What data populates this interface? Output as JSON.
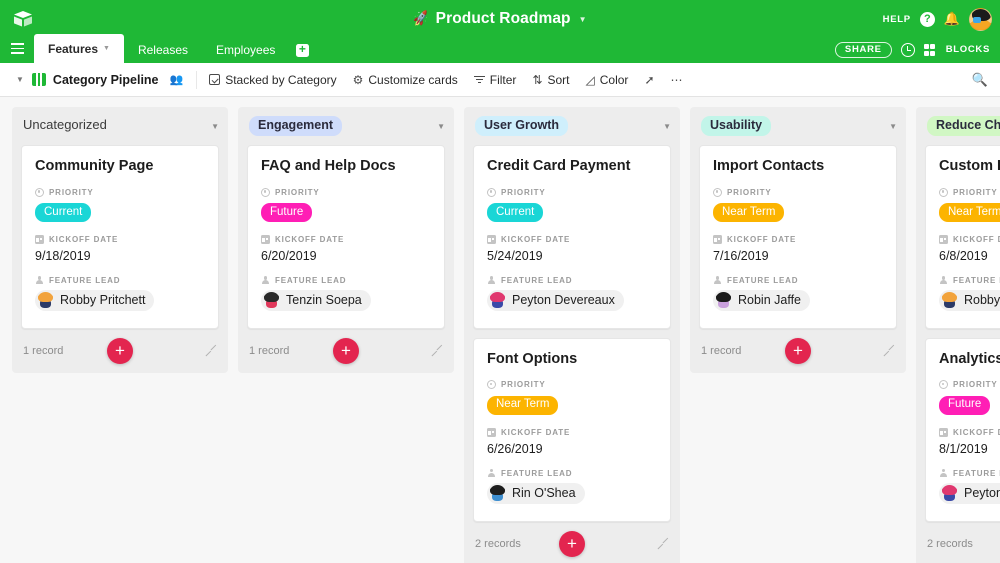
{
  "colors": {
    "brand_green": "#1fb836",
    "accent_red": "#e3254f",
    "chip_current": "#1ad6d6",
    "chip_future": "#ff1eb5",
    "chip_near_term": "#fcb400",
    "stack_engagement": "#cfdcfb",
    "stack_user_growth": "#cfeffc",
    "stack_usability": "#c2f5e9",
    "stack_reduce_churn": "#d1f7c4"
  },
  "topbar": {
    "logo": "airtable-cube-logo",
    "title": "Product Roadmap",
    "title_icon": "rocket-icon",
    "title_caret": "chevron-down-icon",
    "help_label": "HELP",
    "help_icon": "question-circle-icon",
    "notification_icon": "bell-icon",
    "avatar": "user-avatar"
  },
  "tabs": {
    "menu_icon": "hamburger-menu-icon",
    "items": [
      {
        "label": "Features",
        "active": true,
        "caret": "chevron-down-icon"
      },
      {
        "label": "Releases",
        "active": false
      },
      {
        "label": "Employees",
        "active": false
      }
    ],
    "add_label": "+",
    "share_label": "SHARE",
    "history_icon": "history-clock-icon",
    "blocks_icon": "blocks-icon",
    "blocks_label": "BLOCKS"
  },
  "viewbar": {
    "caret": "chevron-down-icon",
    "view_icon": "kanban-view-icon",
    "view_name": "Category Pipeline",
    "collaborators_icon": "collaborators-icon",
    "buttons": [
      {
        "label": "Stacked by Category",
        "icon": "stack-checkbox-icon"
      },
      {
        "label": "Customize cards",
        "icon": "gear-icon"
      },
      {
        "label": "Filter",
        "icon": "filter-icon"
      },
      {
        "label": "Sort",
        "icon": "sort-icon"
      },
      {
        "label": "Color",
        "icon": "paint-drop-icon"
      }
    ],
    "share_view_icon": "external-link-icon",
    "more_icon": "ellipsis-icon",
    "search_icon": "search-icon"
  },
  "board": {
    "field_labels": {
      "priority": "PRIORITY",
      "kickoff": "KICKOFF DATE",
      "lead": "FEATURE LEAD"
    },
    "add_label": "+",
    "stacks": [
      {
        "name": "Uncategorized",
        "chip_color": "transparent",
        "plain": true,
        "record_count": "1 record",
        "cards": [
          {
            "title": "Community Page",
            "priority": "Current",
            "priority_color": "#1ad6d6",
            "kickoff": "9/18/2019",
            "lead": "Robby Pritchett",
            "avatar_hair": "#f2a33c",
            "avatar_face": "#2b3a67"
          }
        ]
      },
      {
        "name": "Engagement",
        "chip_color": "#cfdcfb",
        "plain": false,
        "record_count": "1 record",
        "cards": [
          {
            "title": "FAQ and Help Docs",
            "priority": "Future",
            "priority_color": "#ff1eb5",
            "kickoff": "6/20/2019",
            "lead": "Tenzin Soepa",
            "avatar_hair": "#2a2a2a",
            "avatar_face": "#e0385b"
          }
        ]
      },
      {
        "name": "User Growth",
        "chip_color": "#cfeffc",
        "plain": false,
        "record_count": "2 records",
        "cards": [
          {
            "title": "Credit Card Payment",
            "priority": "Current",
            "priority_color": "#1ad6d6",
            "kickoff": "5/24/2019",
            "lead": "Peyton Devereaux",
            "avatar_hair": "#e0386f",
            "avatar_face": "#3a4aa8"
          },
          {
            "title": "Font Options",
            "priority": "Near Term",
            "priority_color": "#fcb400",
            "kickoff": "6/26/2019",
            "lead": "Rin O'Shea",
            "avatar_hair": "#1e1e1e",
            "avatar_face": "#3f8fd0"
          }
        ]
      },
      {
        "name": "Usability",
        "chip_color": "#c2f5e9",
        "plain": false,
        "record_count": "1 record",
        "cards": [
          {
            "title": "Import Contacts",
            "priority": "Near Term",
            "priority_color": "#fcb400",
            "kickoff": "7/16/2019",
            "lead": "Robin Jaffe",
            "avatar_hair": "#1b1b1b",
            "avatar_face": "#c9a0dc"
          }
        ]
      },
      {
        "name": "Reduce Churn",
        "chip_color": "#d1f7c4",
        "plain": false,
        "record_count": "2 records",
        "cards": [
          {
            "title": "Custom Branding",
            "priority": "Near Term",
            "priority_color": "#fcb400",
            "kickoff": "6/8/2019",
            "lead": "Robby Pritchett",
            "avatar_hair": "#f2a33c",
            "avatar_face": "#2b3a67"
          },
          {
            "title": "Analytics",
            "priority": "Future",
            "priority_color": "#ff1eb5",
            "kickoff": "8/1/2019",
            "lead": "Peyton Devereaux",
            "avatar_hair": "#e0386f",
            "avatar_face": "#3a4aa8"
          }
        ]
      }
    ]
  }
}
